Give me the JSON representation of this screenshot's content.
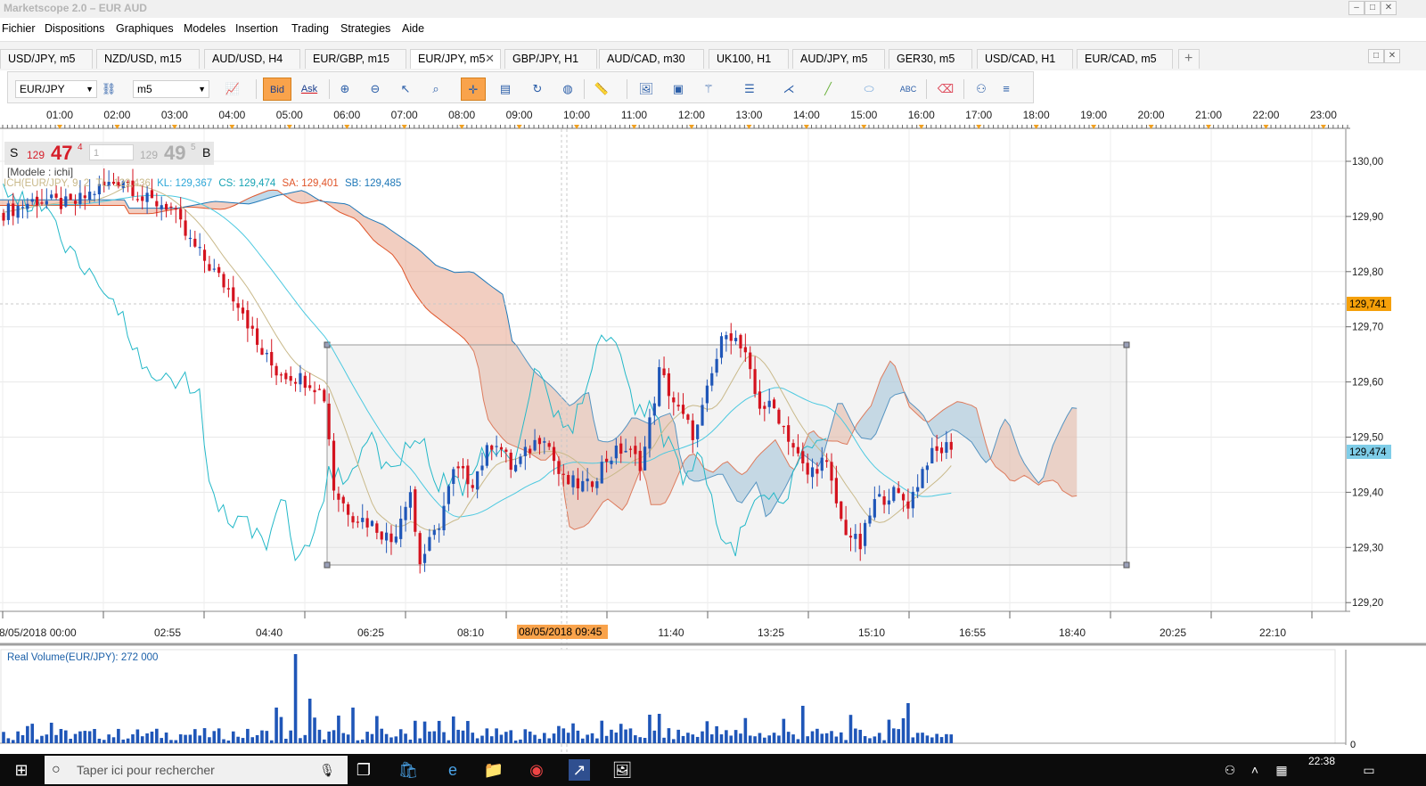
{
  "window": {
    "title": "Marketscope 2.0 – EUR AUD"
  },
  "menu": [
    "Fichier",
    "Dispositions",
    "Graphiques",
    "Modeles",
    "Insertion",
    "Trading",
    "Strategies",
    "Aide"
  ],
  "tabs": [
    "USD/JPY, m5",
    "NZD/USD, m15",
    "AUD/USD, H4",
    "EUR/GBP, m15",
    "EUR/JPY, m5",
    "GBP/JPY, H1",
    "AUD/CAD, m30",
    "UK100, H1",
    "AUD/JPY, m5",
    "GER30, m5",
    "USD/CAD, H1",
    "EUR/CAD, m5"
  ],
  "active_tab": "EUR/JPY, m5",
  "toolbar": {
    "symbol": "EUR/JPY",
    "timeframe": "m5",
    "bid_label": "Bid",
    "ask_label": "Ask"
  },
  "quote": {
    "sell_label": "S",
    "sell_big": "129",
    "sell_pips": "47",
    "sell_frac": "4",
    "amount": "1",
    "buy_big": "129",
    "buy_pips": "49",
    "buy_frac": "5",
    "buy_label": "B"
  },
  "indicators": {
    "model": "[Modele : ichi]",
    "ich_prefix": "ICH(EUR/JPY, 9, 2",
    "tl": "TL: 129,436",
    "kl": "KL: 129,367",
    "cs": "CS: 129,474",
    "sa": "SA: 129,401",
    "sb": "SB: 129,485"
  },
  "time_axis_top": [
    "01:00",
    "02:00",
    "03:00",
    "04:00",
    "05:00",
    "06:00",
    "07:00",
    "08:00",
    "09:00",
    "10:00",
    "11:00",
    "12:00",
    "13:00",
    "14:00",
    "15:00",
    "16:00",
    "17:00",
    "18:00",
    "19:00",
    "20:00",
    "21:00",
    "22:00",
    "23:00"
  ],
  "time_axis_bottom": [
    "08/05/2018 00:00",
    "02:55",
    "04:40",
    "06:25",
    "08:10",
    "11:40",
    "13:25",
    "15:10",
    "16:55",
    "18:40",
    "20:25",
    "22:10"
  ],
  "crosshair_date": "08/05/2018 09:45",
  "price_axis": [
    "130,00",
    "129,90",
    "129,80",
    "129,70",
    "129,60",
    "129,50",
    "129,40",
    "129,30",
    "129,20"
  ],
  "price_tags": {
    "orange": "129,741",
    "blue": "129,474"
  },
  "volume_panel": {
    "label": "Real Volume(EUR/JPY): 272 000",
    "axis_zero": "0"
  },
  "taskbar": {
    "search_placeholder": "Taper ici pour rechercher",
    "clock": "22:38"
  },
  "colors": {
    "bull": "#1f56b8",
    "bear": "#d4121e",
    "kumo_bear": "#e8a58e",
    "kumo_bull": "#93c0dc",
    "chikou": "#23b8c8",
    "tenkan": "#c9b98a",
    "accent": "#f9a34b"
  }
}
